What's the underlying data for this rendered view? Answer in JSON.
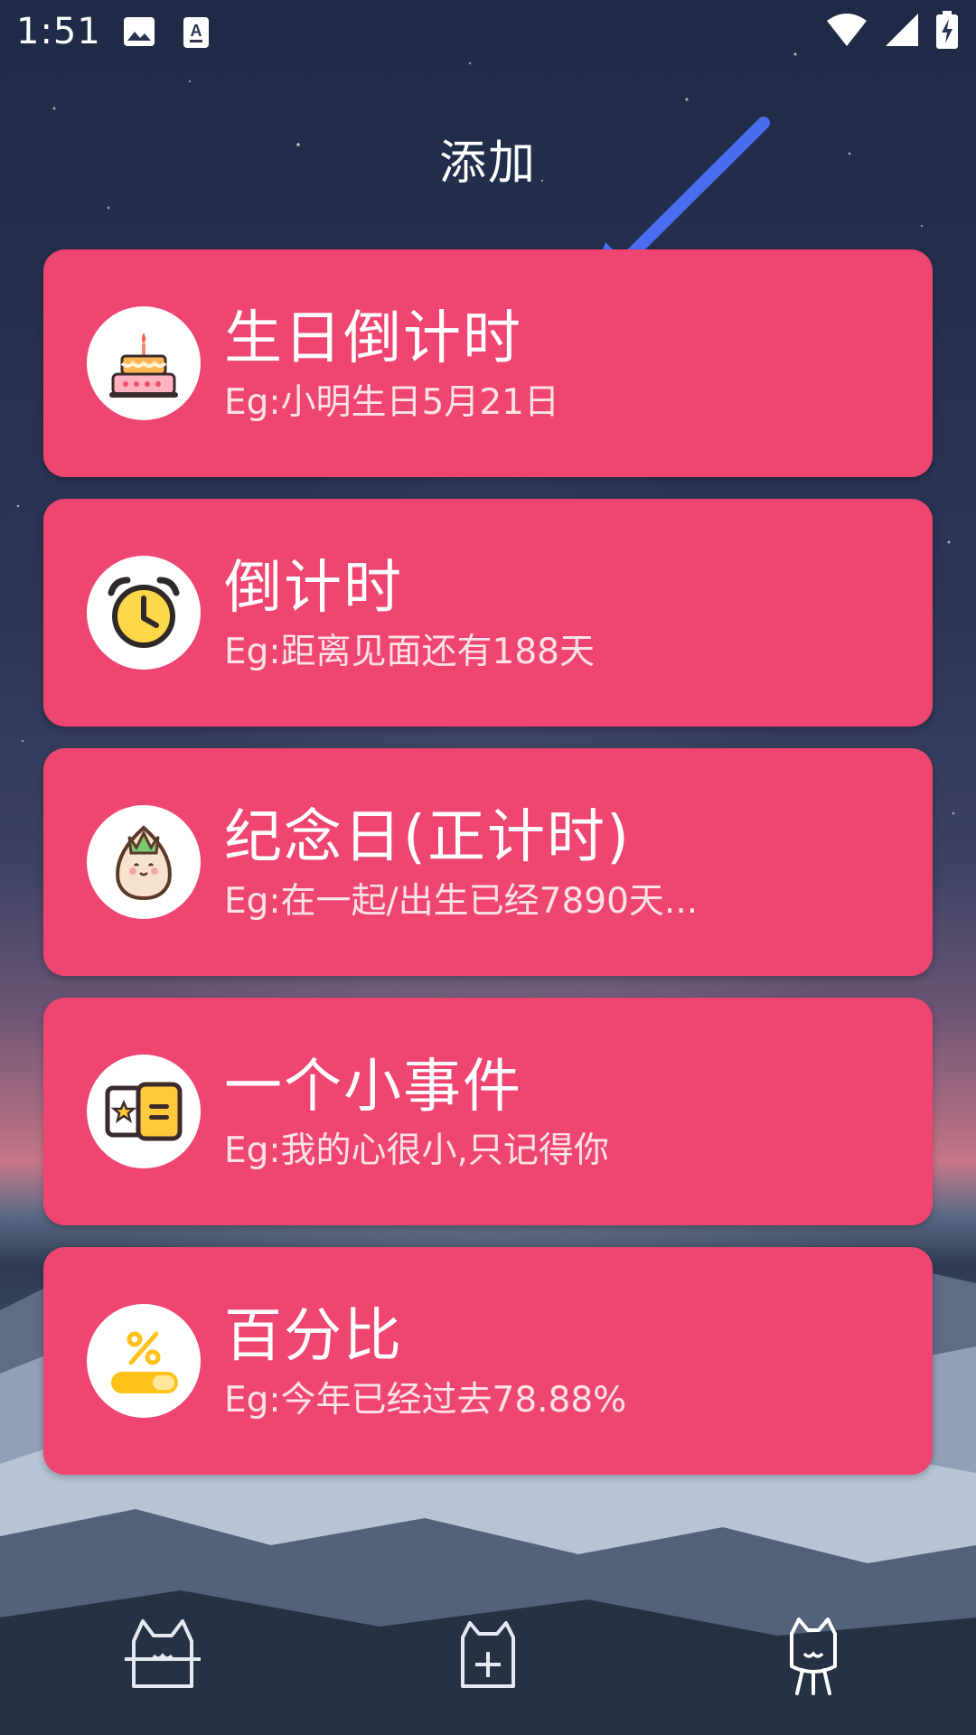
{
  "status_bar": {
    "time": "1:51",
    "left_icons": [
      "image-icon",
      "text-icon"
    ],
    "right_icons": [
      "wifi-icon",
      "signal-icon",
      "battery-charging-icon"
    ]
  },
  "header": {
    "title": "添加"
  },
  "cards": [
    {
      "title": "生日倒计时",
      "subtitle": "Eg:小明生日5月21日",
      "icon": "birthday-cake-icon"
    },
    {
      "title": "倒计时",
      "subtitle": "Eg:距离见面还有188天",
      "icon": "alarm-clock-icon"
    },
    {
      "title": "纪念日(正计时)",
      "subtitle": "Eg:在一起/出生已经7890天...",
      "icon": "cute-seed-icon"
    },
    {
      "title": "一个小事件",
      "subtitle": "Eg:我的心很小,只记得你",
      "icon": "ticket-note-icon"
    },
    {
      "title": "百分比",
      "subtitle": "Eg:今年已经过去78.88%",
      "icon": "percent-toggle-icon"
    }
  ],
  "bottom_nav": {
    "items": [
      "cat-home-icon",
      "cat-add-icon",
      "cat-profile-icon"
    ],
    "active": "cat-profile-icon"
  },
  "colors": {
    "card": "#ee4670",
    "annotation_arrow": "#4a6df0"
  }
}
